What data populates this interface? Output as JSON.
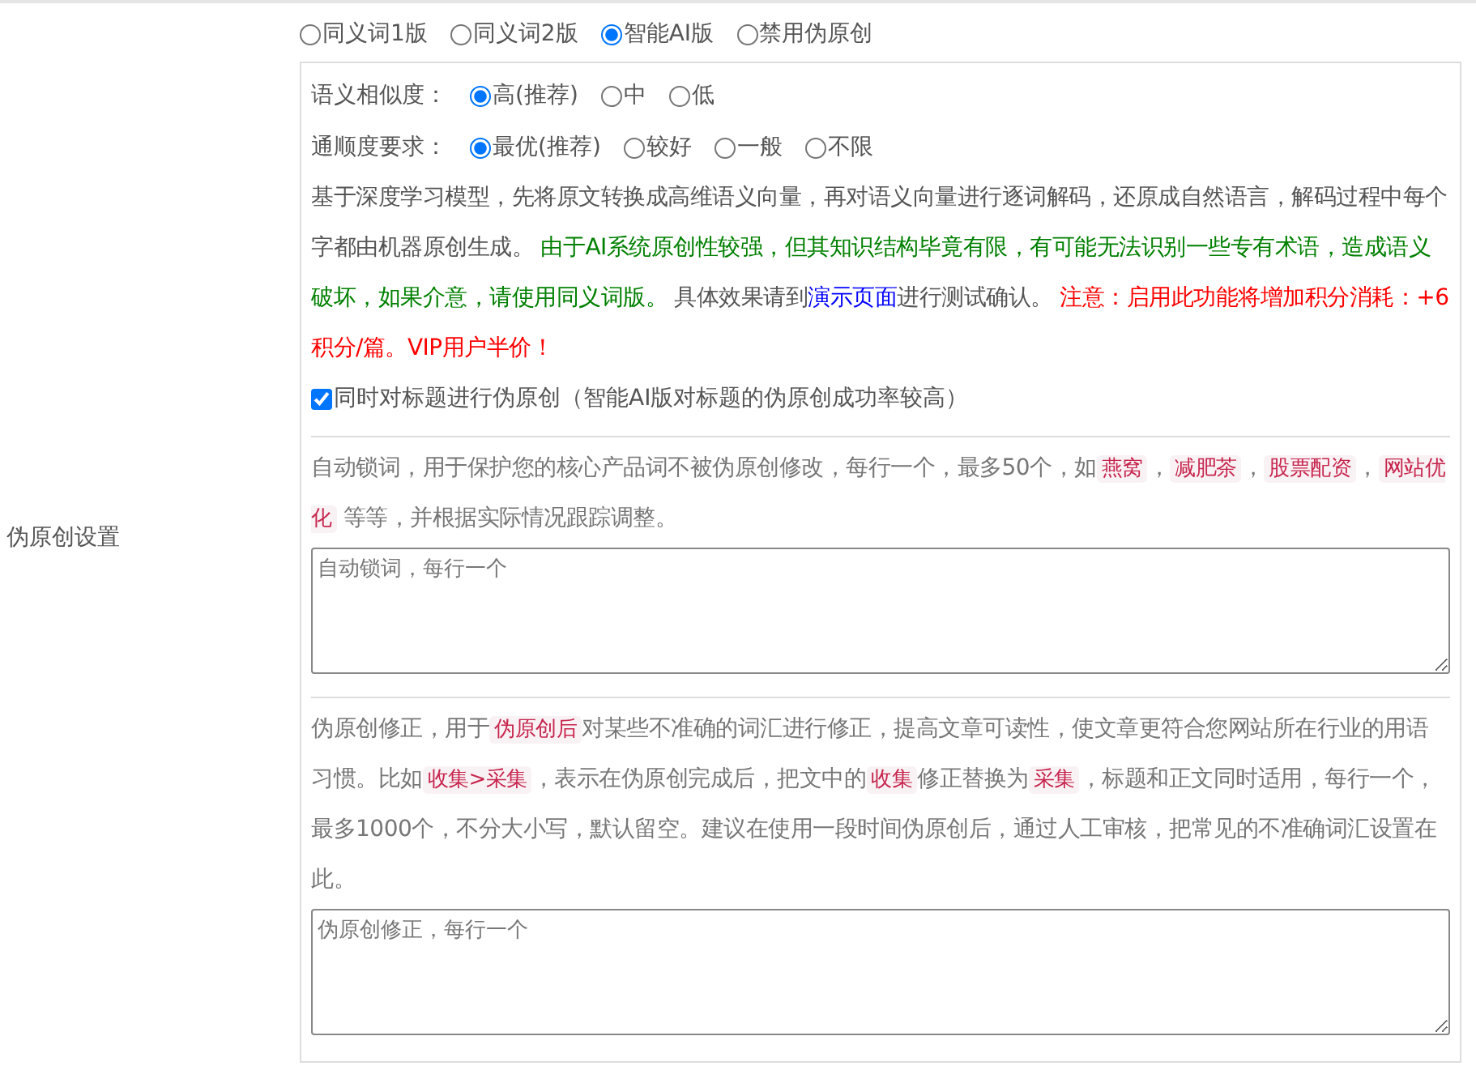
{
  "label": "伪原创设置",
  "modes": [
    {
      "label": "同义词1版",
      "selected": false
    },
    {
      "label": "同义词2版",
      "selected": false
    },
    {
      "label": "智能AI版",
      "selected": true
    },
    {
      "label": "禁用伪原创",
      "selected": false
    }
  ],
  "similarity": {
    "label": "语义相似度：",
    "options": [
      {
        "label": "高(推荐)",
        "selected": true
      },
      {
        "label": "中",
        "selected": false
      },
      {
        "label": "低",
        "selected": false
      }
    ]
  },
  "fluency": {
    "label": "通顺度要求：",
    "options": [
      {
        "label": "最优(推荐)",
        "selected": true
      },
      {
        "label": "较好",
        "selected": false
      },
      {
        "label": "一般",
        "selected": false
      },
      {
        "label": "不限",
        "selected": false
      }
    ]
  },
  "ai_description": [
    {
      "kind": "text",
      "text": "基于深度学习模型，先将原文转换成高维语义向量，再对语义向量进行逐词解码，还原成自然语言，解码过程中每个字都由机器原创生成。 "
    },
    {
      "kind": "note",
      "text": "由于AI系统原创性较强，但其知识结构毕竟有限，有可能无法识别一些专有术语，造成语义破坏，如果介意，请使用同义词版。"
    },
    {
      "kind": "text",
      "text": " 具体效果请到"
    },
    {
      "kind": "link",
      "text": "演示页面"
    },
    {
      "kind": "text",
      "text": "进行测试确认。 "
    },
    {
      "kind": "warning",
      "text": "注意：启用此功能将增加积分消耗：+6积分/篇。VIP用户半价！"
    }
  ],
  "title_option": {
    "label": "同时对标题进行伪原创（智能AI版对标题的伪原创成功率较高）",
    "checked": true
  },
  "lock_words": {
    "description": [
      {
        "kind": "text",
        "text": "自动锁词，用于保护您的核心产品词不被伪原创修改，每行一个，最多50个，如"
      },
      {
        "kind": "code",
        "text": "燕窝"
      },
      {
        "kind": "text",
        "text": "，"
      },
      {
        "kind": "code",
        "text": "减肥茶"
      },
      {
        "kind": "text",
        "text": "，"
      },
      {
        "kind": "code",
        "text": "股票配资"
      },
      {
        "kind": "text",
        "text": "，"
      },
      {
        "kind": "code",
        "text": "网站优化"
      },
      {
        "kind": "text",
        "text": " 等等，并根据实际情况跟踪调整。"
      }
    ],
    "placeholder": "自动锁词，每行一个"
  },
  "corrections": {
    "description": [
      {
        "kind": "text",
        "text": "伪原创修正，用于"
      },
      {
        "kind": "code",
        "text": "伪原创后"
      },
      {
        "kind": "text",
        "text": "对某些不准确的词汇进行修正，提高文章可读性，使文章更符合您网站所在行业的用语习惯。比如"
      },
      {
        "kind": "code",
        "text": "收集>采集"
      },
      {
        "kind": "text",
        "text": "，表示在伪原创完成后，把文中的"
      },
      {
        "kind": "code",
        "text": "收集"
      },
      {
        "kind": "text",
        "text": "修正替换为"
      },
      {
        "kind": "code",
        "text": "采集"
      },
      {
        "kind": "text",
        "text": "，标题和正文同时适用，每行一个，最多1000个，不分大小写，默认留空。建议在使用一段时间伪原创后，通过人工审核，把常见的不准确词汇设置在此。"
      }
    ],
    "placeholder": "伪原创修正，每行一个"
  }
}
